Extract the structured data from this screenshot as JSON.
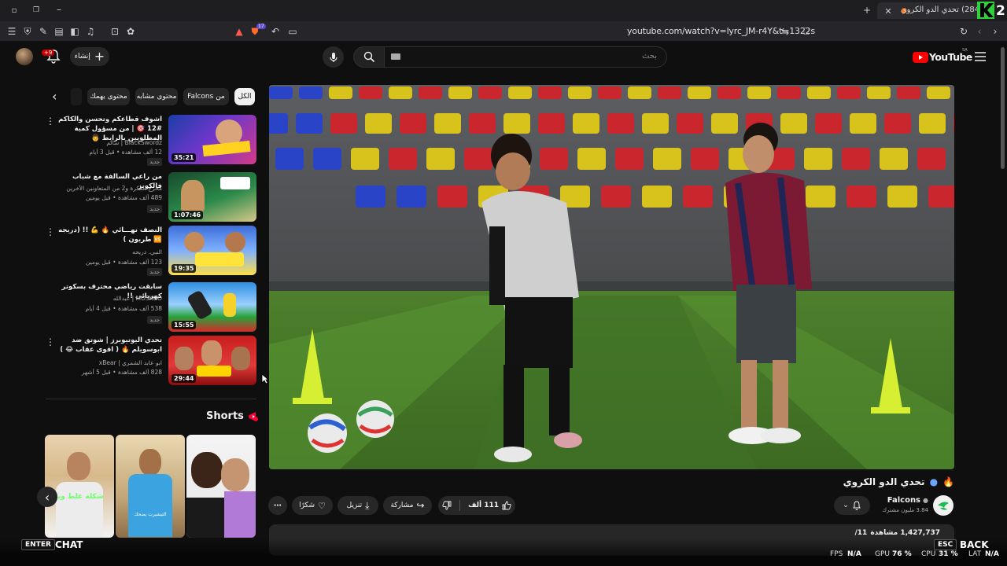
{
  "browser": {
    "url": "youtube.com/watch?v=lyrc_JM-r4Y&t=1322s",
    "tab_title": "(284) تحدي الدو الكروي",
    "shield_count": "17"
  },
  "header": {
    "logo_text": "YouTube",
    "logo_region": "SA",
    "search_placeholder": "بحث",
    "create_label": "إنشاء",
    "notifications_badge": "+9"
  },
  "chips": [
    "الكل",
    "من Falcons",
    "محتوى مشابه",
    "محتوى يهمك"
  ],
  "related": [
    {
      "title": "اشوف قطاعكم وتحسن والكاكم #12 🎯 | من مسؤول كمية المطلوبين بالرابط 👨",
      "channel": "BlackSwordz | سالم",
      "meta": "12 ألف مشاهدة • قبل 3 أيام",
      "badge": "جديد",
      "duration": "35:21"
    },
    {
      "title": "من راعي السالفة مع شباب فالكونز",
      "channel": "مخرج الفكرة و2 من المتعاونين الآخرين",
      "meta": "489 ألف مشاهدة • قبل يومين",
      "badge": "جديد",
      "duration": "1:07:46"
    },
    {
      "title": "النصف نهـــائي 🔥 💪 !! (دريجه 🆚 طربون )",
      "channel": "النبي. دريحه",
      "meta": "123 ألف مشاهدة • قبل يومين",
      "badge": "جديد",
      "duration": "19:35"
    },
    {
      "title": "سابقت رياضي محترف بسكوتر كهربائي !!",
      "channel": "MOSKOO | عبدالله",
      "meta": "538 ألف مشاهدة • قبل 4 أيام",
      "badge": "جديد",
      "duration": "15:55"
    },
    {
      "title": "تحدي اليوتيوبرز | شوتق ضد ابوسويلم 🔥 ( اقوى عقاب 😂 )",
      "channel": "ابو عابد الشمري | xBear",
      "meta": "828 ألف مشاهدة • قبل 5 أشهر",
      "badge": "",
      "duration": "29:44"
    }
  ],
  "shorts": {
    "heading": "Shorts",
    "items": [
      {
        "caption": "شكلة غلط وبا"
      },
      {
        "caption": "التيشيرت يضحك"
      },
      {
        "caption": ""
      }
    ]
  },
  "video": {
    "title": "تحدي الدو الكروي",
    "channel_name": "Falcons",
    "subscribers": "3.84 مليون مشترك",
    "likes": "111 ألف",
    "share_label": "مشاركة",
    "download_label": "تنزيل",
    "thanks_label": "شكرًا",
    "views": "1,427,737 مشاهدة",
    "date": "11/"
  },
  "hud": {
    "enter_key": "ENTER",
    "chat_label": "CHAT",
    "esc_key": "ESC",
    "back_label": "BACK",
    "fps_label": "FPS",
    "fps_value": "N/A",
    "gpu_label": "GPU",
    "gpu_value": "76 %",
    "cpu_label": "CPU",
    "cpu_value": "31 %",
    "lat_label": "LAT",
    "lat_value": "N/A",
    "corner_badge": "K2"
  },
  "colors": {
    "youtube_red": "#ff0000",
    "background": "#0f0f0f",
    "chip_bg": "#272727",
    "corner_badge_green": "#2ed13a"
  }
}
